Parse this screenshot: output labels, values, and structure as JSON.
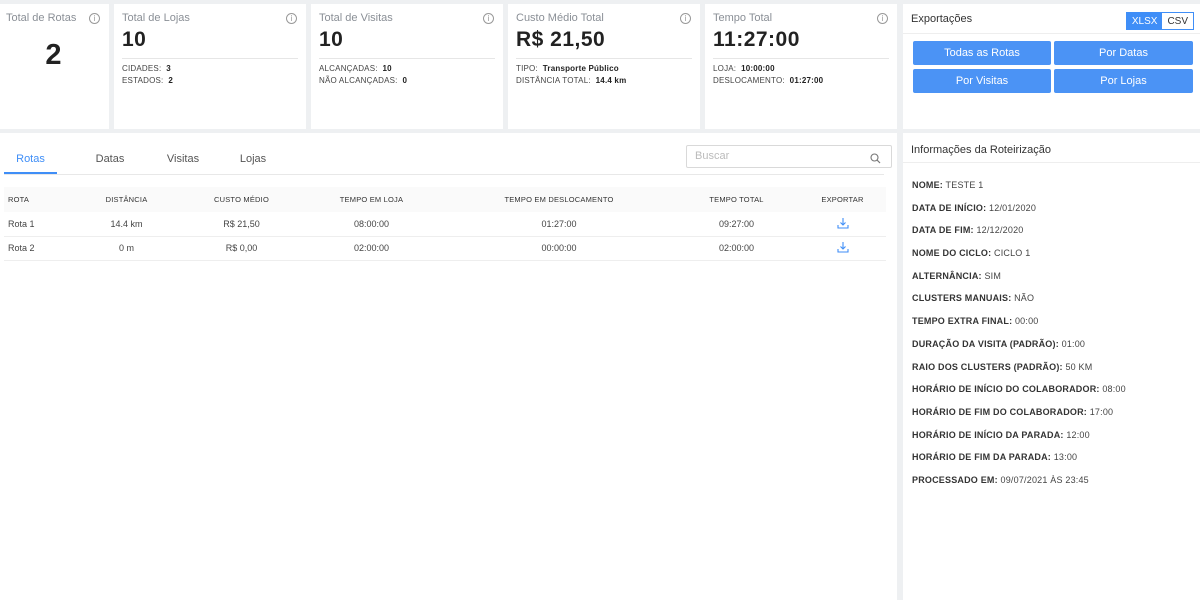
{
  "cards": {
    "rotas": {
      "title": "Total de Rotas",
      "value": "2"
    },
    "lojas": {
      "title": "Total de Lojas",
      "value": "10",
      "line1_label": "CIDADES:",
      "line1_value": "3",
      "line2_label": "ESTADOS:",
      "line2_value": "2"
    },
    "visitas": {
      "title": "Total de Visitas",
      "value": "10",
      "line1_label": "ALCANÇADAS:",
      "line1_value": "10",
      "line2_label": "NÃO ALCANÇADAS:",
      "line2_value": "0"
    },
    "custo": {
      "title": "Custo Médio Total",
      "value": "R$ 21,50",
      "line1_label": "TIPO:",
      "line1_value": "Transporte Público",
      "line2_label": "DISTÂNCIA TOTAL:",
      "line2_value": "14.4 km"
    },
    "tempo": {
      "title": "Tempo Total",
      "value": "11:27:00",
      "line1_label": "LOJA:",
      "line1_value": "10:00:00",
      "line2_label": "DESLOCAMENTO:",
      "line2_value": "01:27:00"
    },
    "info_glyph": "i"
  },
  "exports": {
    "title": "Exportações",
    "format_xlsx": "XLSX",
    "format_csv": "CSV",
    "selected_format": "XLSX",
    "buttons": [
      "Todas as Rotas",
      "Por Datas",
      "Por Visitas",
      "Por Lojas"
    ]
  },
  "tabs": [
    "Rotas",
    "Datas",
    "Visitas",
    "Lojas"
  ],
  "active_tab": "Rotas",
  "search": {
    "placeholder": "Buscar",
    "value": ""
  },
  "table": {
    "headers": [
      "ROTA",
      "DISTÂNCIA",
      "CUSTO MÉDIO",
      "TEMPO EM LOJA",
      "TEMPO EM DESLOCAMENTO",
      "TEMPO TOTAL",
      "EXPORTAR"
    ],
    "rows": [
      [
        "Rota 1",
        "14.4 km",
        "R$ 21,50",
        "08:00:00",
        "01:27:00",
        "09:27:00"
      ],
      [
        "Rota 2",
        "0 m",
        "R$ 0,00",
        "02:00:00",
        "00:00:00",
        "02:00:00"
      ]
    ]
  },
  "side": {
    "title": "Informações da Roteirização",
    "items": [
      {
        "key": "NOME:",
        "value": "TESTE 1"
      },
      {
        "key": "DATA DE INÍCIO:",
        "value": "12/01/2020"
      },
      {
        "key": "DATA DE FIM:",
        "value": "12/12/2020"
      },
      {
        "key": "NOME DO CICLO:",
        "value": "CICLO 1"
      },
      {
        "key": "ALTERNÂNCIA:",
        "value": "SIM"
      },
      {
        "key": "CLUSTERS MANUAIS:",
        "value": "NÃO"
      },
      {
        "key": "TEMPO EXTRA FINAL:",
        "value": "00:00"
      },
      {
        "key": "DURAÇÃO DA VISITA (PADRÃO):",
        "value": "01:00"
      },
      {
        "key": "RAIO DOS CLUSTERS (PADRÃO):",
        "value": "50 KM"
      },
      {
        "key": "HORÁRIO DE INÍCIO DO COLABORADOR:",
        "value": "08:00"
      },
      {
        "key": "HORÁRIO DE FIM DO COLABORADOR:",
        "value": "17:00"
      },
      {
        "key": "HORÁRIO DE INÍCIO DA PARADA:",
        "value": "12:00"
      },
      {
        "key": "HORÁRIO DE FIM DA PARADA:",
        "value": "13:00"
      },
      {
        "key": "PROCESSADO EM:",
        "value": "09/07/2021 ÀS 23:45"
      }
    ]
  },
  "colors": {
    "accent": "#3f8ef7",
    "button": "#4b93f5"
  },
  "icons": {
    "info": "info-icon",
    "search": "search-icon",
    "download": "download-icon"
  }
}
